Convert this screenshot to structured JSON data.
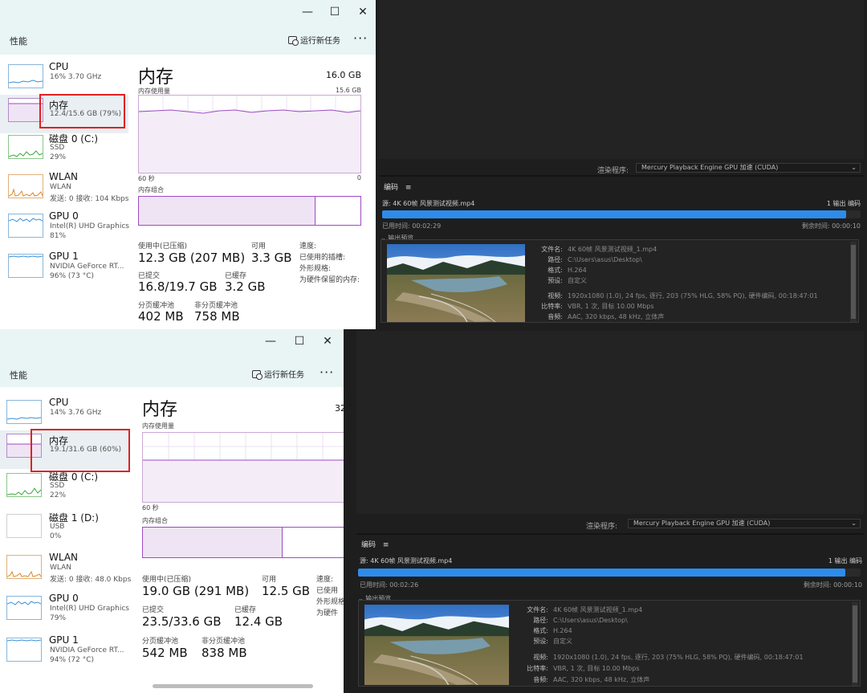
{
  "tm1": {
    "window_controls": {
      "minimize": "—",
      "maximize": "☐",
      "close": "✕"
    },
    "header": {
      "title": "性能",
      "run_task": "运行新任务",
      "more": "···"
    },
    "sidebar": [
      {
        "name": "CPU",
        "sub1": "16%  3.70 GHz",
        "sub2": ""
      },
      {
        "name": "内存",
        "sub1": "12.4/15.6 GB (79%)",
        "sub2": ""
      },
      {
        "name": "磁盘 0 (C:)",
        "sub1": "SSD",
        "sub2": "29%"
      },
      {
        "name": "WLAN",
        "sub1": "WLAN",
        "sub2": "发送: 0 接收: 104 Kbps"
      },
      {
        "name": "GPU 0",
        "sub1": "Intel(R) UHD Graphics",
        "sub2": "81%"
      },
      {
        "name": "GPU 1",
        "sub1": "NVIDIA GeForce RT...",
        "sub2": "96% (73 °C)"
      }
    ],
    "main": {
      "title": "内存",
      "total": "16.0 GB",
      "usage_label": "内存使用量",
      "usage_max": "15.6 GB",
      "time_left": "60 秒",
      "time_right": "0",
      "composition_label": "内存组合",
      "composition_in_use": 0.79,
      "in_use_label": "使用中(已压缩)",
      "in_use_value": "12.3 GB (207 MB)",
      "available_label": "可用",
      "available_value": "3.3 GB",
      "committed_label": "已提交",
      "committed_value": "16.8/19.7 GB",
      "cached_label": "已缓存",
      "cached_value": "3.2 GB",
      "paged_label": "分页缓冲池",
      "paged_value": "402 MB",
      "nonpaged_label": "非分页缓冲池",
      "nonpaged_value": "758 MB",
      "speed_label": "速度:",
      "slots_label": "已使用的插槽:",
      "form_label": "外形规格:",
      "reserved_label": "为硬件保留的内存:"
    }
  },
  "tm2": {
    "window_controls": {
      "minimize": "—",
      "maximize": "☐",
      "close": "✕"
    },
    "header": {
      "title": "性能",
      "run_task": "运行新任务",
      "more": "···"
    },
    "sidebar": [
      {
        "name": "CPU",
        "sub1": "14%  3.76 GHz",
        "sub2": ""
      },
      {
        "name": "内存",
        "sub1": "19.1/31.6 GB (60%)",
        "sub2": ""
      },
      {
        "name": "磁盘 0 (C:)",
        "sub1": "SSD",
        "sub2": "22%"
      },
      {
        "name": "磁盘 1 (D:)",
        "sub1": "USB",
        "sub2": "0%"
      },
      {
        "name": "WLAN",
        "sub1": "WLAN",
        "sub2": "发送: 0 接收: 48.0 Kbps"
      },
      {
        "name": "GPU 0",
        "sub1": "Intel(R) UHD Graphics",
        "sub2": "79%"
      },
      {
        "name": "GPU 1",
        "sub1": "NVIDIA GeForce RT...",
        "sub2": "94% (72 °C)"
      }
    ],
    "main": {
      "title": "内存",
      "total": "32",
      "usage_label": "内存使用量",
      "time_left": "60 秒",
      "composition_label": "内存组合",
      "composition_in_use": 0.6,
      "in_use_label": "使用中(已压缩)",
      "in_use_value": "19.0 GB (291 MB)",
      "available_label": "可用",
      "available_value": "12.5 GB",
      "committed_label": "已提交",
      "committed_value": "23.5/33.6 GB",
      "cached_label": "已缓存",
      "cached_value": "12.4 GB",
      "paged_label": "分页缓冲池",
      "paged_value": "542 MB",
      "nonpaged_label": "非分页缓冲池",
      "nonpaged_value": "838 MB",
      "speed_label": "速度:",
      "slots_label": "已使用",
      "form_label": "外形规格",
      "reserved_label": "为硬件"
    }
  },
  "pr1": {
    "renderer_label": "渲染程序:",
    "renderer_value": "Mercury Playback Engine GPU 加速 (CUDA)",
    "encode_tab": "编码",
    "menu_icon": "≡",
    "source": "源: 4K 60帧 风景测试视频.mp4",
    "output_count": "1 输出 编码",
    "progress": 0.97,
    "elapsed": "已用时间: 00:02:29",
    "remaining": "剩余时间: 00:00:10",
    "output_preview": "输出预览",
    "file_k": "文件名:",
    "file_v": "4K 60帧 风景测试视频_1.mp4",
    "path_k": "路径:",
    "path_v": "C:\\Users\\asus\\Desktop\\",
    "format_k": "格式:",
    "format_v": "H.264",
    "preset_k": "预设:",
    "preset_v": "自定义",
    "video_k": "视频:",
    "video_v": "1920x1080 (1.0), 24 fps, 逐行, 203 (75% HLG, 58% PQ), 硬件编码, 00:18:47:01",
    "bitrate_k": "比特率:",
    "bitrate_v": "VBR, 1 次, 目标 10.00 Mbps",
    "audio_k": "音频:",
    "audio_v": "AAC, 320 kbps, 48 kHz, 立体声"
  },
  "pr2": {
    "renderer_label": "渲染程序:",
    "renderer_value": "Mercury Playback Engine GPU 加速 (CUDA)",
    "encode_tab": "编码",
    "menu_icon": "≡",
    "source": "源: 4K 60帧 风景测试视频.mp4",
    "output_count": "1 输出 编码",
    "progress": 0.97,
    "elapsed": "已用时间: 00:02:26",
    "remaining": "剩余时间: 00:00:10",
    "output_preview": "输出预览",
    "file_k": "文件名:",
    "file_v": "4K 60帧 风景测试视频_1.mp4",
    "path_k": "路径:",
    "path_v": "C:\\Users\\asus\\Desktop\\",
    "format_k": "格式:",
    "format_v": "H.264",
    "preset_k": "预设:",
    "preset_v": "自定义",
    "video_k": "视频:",
    "video_v": "1920x1080 (1.0), 24 fps, 逐行, 203 (75% HLG, 58% PQ), 硬件编码, 00:18:47:01",
    "bitrate_k": "比特率:",
    "bitrate_v": "VBR, 1 次, 目标 10.00 Mbps",
    "audio_k": "音频:",
    "audio_v": "AAC, 320 kbps, 48 kHz, 立体声"
  },
  "colors": {
    "accent_blue": "#2d8ceb",
    "memory_purple": "#9b4cc4",
    "highlight_red": "#e02020",
    "dark_bg": "#1e1e1e"
  }
}
